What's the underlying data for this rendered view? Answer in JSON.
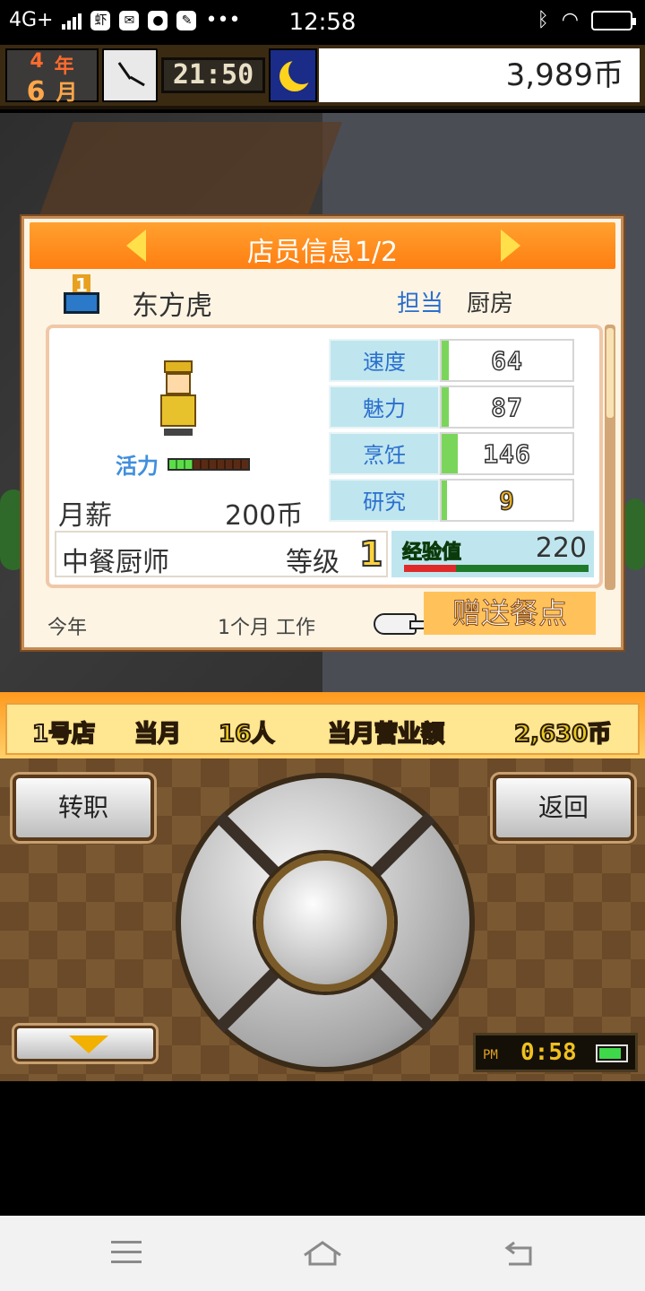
{
  "status_bar": {
    "network": "4G+",
    "time": "12:58",
    "app_icon_1": "虾",
    "icons": [
      "signal-icon",
      "notification-icons",
      "bluetooth-icon",
      "wifi-icon",
      "battery-icon"
    ]
  },
  "hud": {
    "year_num": "4",
    "year_unit": "年",
    "month_num": "6",
    "month_unit": "月",
    "game_time": "21:50",
    "money": "3,989币"
  },
  "panel": {
    "title": "店员信息1/2",
    "rank": "1",
    "staff_name": "东方虎",
    "role_label": "担当",
    "role_value": "厨房",
    "energy_label": "活力",
    "energy_level": 0.3,
    "salary_label": "月薪",
    "salary_value": "200币",
    "stats": [
      {
        "name": "速度",
        "value": "64"
      },
      {
        "name": "魅力",
        "value": "87"
      },
      {
        "name": "烹饪",
        "value": "146"
      },
      {
        "name": "研究",
        "value": "9"
      }
    ],
    "job_name": "中餐厨师",
    "level_label": "等级",
    "level_value": "1",
    "exp_label": "经验值",
    "exp_value": "220",
    "exp_progress": 0.28,
    "footer_year": "今年",
    "footer_months": "1个月 工作",
    "gift_button": "赠送餐点"
  },
  "strip": {
    "store": "1号店",
    "this_month": "当月",
    "count": "16人",
    "revenue_label": "当月营业额",
    "revenue_value": "2,630币"
  },
  "controls": {
    "transfer": "转职",
    "back": "返回",
    "pm": "PM",
    "clock": "0:58",
    "battery_level": 0.85
  },
  "colors": {
    "title_orange": "#ff8a1a",
    "stat_blue": "#bfe6ee",
    "bar_green": "#7ad65a"
  }
}
